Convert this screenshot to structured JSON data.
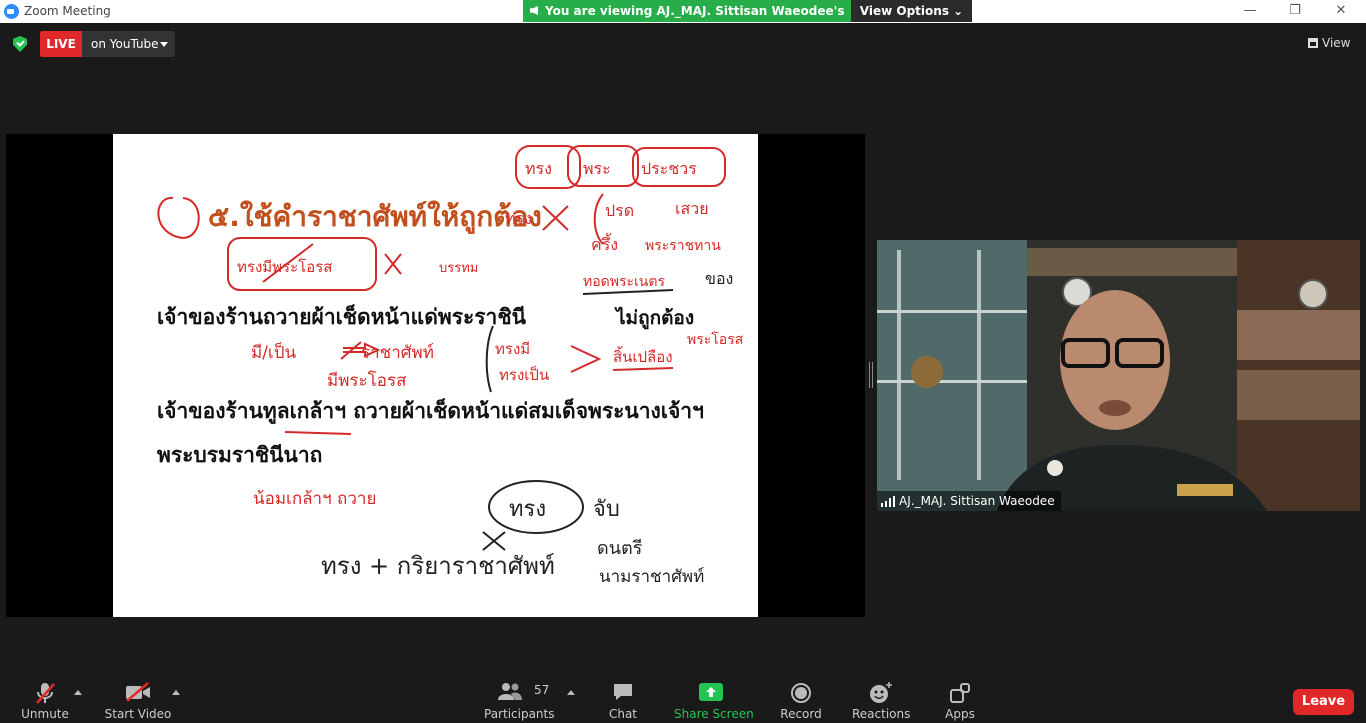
{
  "window": {
    "title": "Zoom Meeting",
    "minimize": "—",
    "restore": "❐",
    "close": "✕"
  },
  "banner": {
    "text": "You are viewing AJ._MAJ. Sittisan  Waeodee's screen",
    "view_options": "View Options ⌄"
  },
  "topbar": {
    "live_label": "LIVE",
    "stream_target": "on YouTube",
    "view_label": "View"
  },
  "slide": {
    "heading": "๕.ใช้คำราชาศัพท์ให้ถูกต้อง",
    "sentence_1": "เจ้าของร้านถวายผ้าเช็ดหน้าแด่พระราชินี",
    "verdict": "ไม่ถูกต้อง",
    "sentence_2": "เจ้าของร้านทูลเกล้าฯ ถวายผ้าเช็ดหน้าแด่สมเด็จพระนางเจ้าฯ",
    "sentence_3": "พระบรมราชินีนาถ",
    "notes": {
      "n1": "ทรง",
      "n2": "พระ",
      "n3": "ประชวร",
      "n4": "ทรง",
      "n5": "ปรด",
      "n6": "เสวย",
      "n7": "ครึ้ง",
      "n8": "พระราชทาน",
      "n9": "ทอดพระเนตร",
      "n10": "ของ",
      "n11": "ทรงมีพระโอรส",
      "n12": "บรรทม",
      "n13": "มี/เป็น",
      "n14": "ราชาศัพท์",
      "n15": "มีพระโอรส",
      "n16": "ทรงมี",
      "n17": "ทรงเป็น",
      "n18": "สิ้นเปลือง",
      "n19": "พระโอรส",
      "n20": "น้อมเกล้าฯ ถวาย",
      "n21": "ทรง",
      "n22": "จับ",
      "n23": "ทรง + กริยาราชาศัพท์",
      "n24": "ดนตรี",
      "n25": "นามราชาศัพท์"
    }
  },
  "video": {
    "name": "AJ._MAJ. Sittisan  Waeodee"
  },
  "toolbar": {
    "unmute": "Unmute",
    "start_video": "Start Video",
    "participants": "Participants",
    "participants_count": "57",
    "chat": "Chat",
    "share_screen": "Share Screen",
    "record": "Record",
    "reactions": "Reactions",
    "apps": "Apps",
    "leave": "Leave"
  },
  "colors": {
    "live_red": "#e02828",
    "banner_green": "#27ae4a",
    "share_green": "#23c552",
    "ink_red": "#d42a2a",
    "heading_brown": "#c0501e"
  }
}
